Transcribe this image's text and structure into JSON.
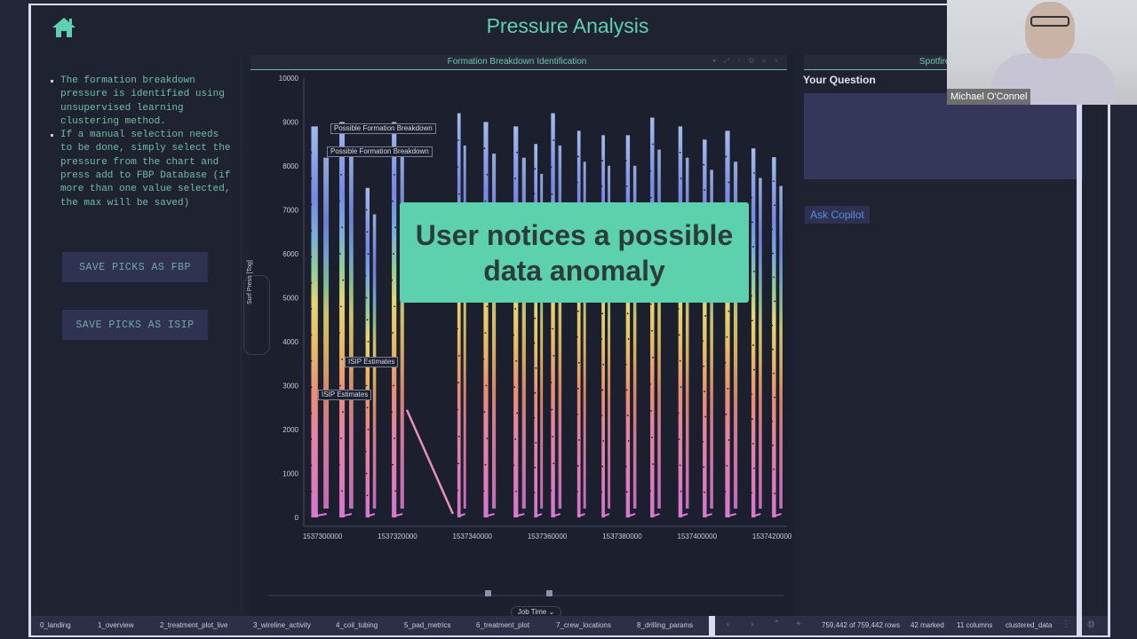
{
  "header": {
    "title": "Pressure Analysis",
    "home_icon": "home-icon"
  },
  "left_panel": {
    "notes": [
      "The formation breakdown pressure is identified using unsupervised learning clustering method.",
      "If a manual selection needs to be done, simply select the pressure from the chart and press add to FBP Database (if more than one value selected, the max will be saved)"
    ],
    "buttons": {
      "save_fbp": "SAVE PICKS AS FBP",
      "save_isip": "SAVE PICKS AS ISIP"
    }
  },
  "chart_panel": {
    "title": "Formation Breakdown Identification",
    "toolbar_icons": [
      "pin-icon",
      "expand-icon",
      "copy-icon",
      "settings-icon",
      "menu-icon",
      "close-icon"
    ],
    "x_selector": "Job Time",
    "range_slider": {
      "low_fraction": 0.42,
      "high_fraction": 0.54
    },
    "overlay_caption": "User notices a possible data anomaly"
  },
  "chart_data": {
    "type": "line",
    "title": "Formation Breakdown Identification",
    "xlabel": "Job Time",
    "ylabel": "Surf Press [Tog]",
    "xlim": [
      1537295000,
      1537424000
    ],
    "ylim": [
      0,
      10000
    ],
    "x_ticks": [
      1537300000,
      1537320000,
      1537340000,
      1537360000,
      1537380000,
      1537400000,
      1537420000
    ],
    "x_tick_labels": [
      "1537300000",
      "1537320000",
      "1537340000",
      "1537360000",
      "1537380000",
      "1537400000",
      "1537420000"
    ],
    "y_ticks": [
      0,
      1000,
      2000,
      3000,
      4000,
      5000,
      6000,
      7000,
      8000,
      9000,
      10000
    ],
    "y_tick_labels": [
      "0",
      "1000",
      "2000",
      "3000",
      "4000",
      "5000",
      "6000",
      "7000",
      "8000",
      "9000",
      "10000"
    ],
    "grid": false,
    "color_scale": "pressure gradient (pink low to blue high)",
    "stages": [
      {
        "start": 1537297000,
        "peak": 8900,
        "end": 1537302000
      },
      {
        "start": 1537304500,
        "peak": 9000,
        "end": 1537308500
      },
      {
        "start": 1537311500,
        "peak": 7500,
        "end": 1537314500
      },
      {
        "start": 1537318500,
        "peak": 9000,
        "end": 1537322000
      },
      {
        "start": 1537336000,
        "peak": 9200,
        "end": 1537338500
      },
      {
        "start": 1537343000,
        "peak": 9000,
        "end": 1537346500
      },
      {
        "start": 1537351000,
        "peak": 8900,
        "end": 1537354500
      },
      {
        "start": 1537356500,
        "peak": 8500,
        "end": 1537359000
      },
      {
        "start": 1537361000,
        "peak": 9200,
        "end": 1537364000
      },
      {
        "start": 1537368000,
        "peak": 8800,
        "end": 1537370500
      },
      {
        "start": 1537374500,
        "peak": 8700,
        "end": 1537377000
      },
      {
        "start": 1537381000,
        "peak": 8700,
        "end": 1537384000
      },
      {
        "start": 1537387500,
        "peak": 9100,
        "end": 1537390500
      },
      {
        "start": 1537395000,
        "peak": 8900,
        "end": 1537398000
      },
      {
        "start": 1537401500,
        "peak": 8600,
        "end": 1537404500
      },
      {
        "start": 1537407500,
        "peak": 8800,
        "end": 1537411000
      },
      {
        "start": 1537414500,
        "peak": 8400,
        "end": 1537417500
      },
      {
        "start": 1537420000,
        "peak": 8200,
        "end": 1537423000
      }
    ],
    "anomaly_ramp": {
      "from": [
        1537322500,
        2450
      ],
      "to": [
        1537334800,
        80
      ]
    },
    "annotations": [
      {
        "text": "Possible Formation Breakdown",
        "x": 1537304000,
        "y": 8750
      },
      {
        "text": "Possible Formation Breakdown",
        "x": 1537303000,
        "y": 8220
      },
      {
        "text": "ISIP Estimates",
        "x": 1537305500,
        "y": 3480
      },
      {
        "text": "ISIP Estimates",
        "x": 1537299000,
        "y": 2750
      }
    ]
  },
  "right_panel": {
    "tab_label": "Spotfire",
    "question_label": "Your Question",
    "question_value": "",
    "ask_button": "Ask Copilot"
  },
  "video": {
    "participant_name": "Michael O'Connel"
  },
  "status_bar": {
    "pages": [
      "0_landing",
      "1_overview",
      "2_treatment_plot_live",
      "3_wireline_activity",
      "4_coil_tubing",
      "5_pad_metrics",
      "6_treatment_plot",
      "7_crew_locations",
      "8_drilling_params"
    ],
    "rows": "759,442 of 759,442 rows",
    "marked": "42 marked",
    "columns": "11 columns",
    "table": "clustered_data"
  }
}
